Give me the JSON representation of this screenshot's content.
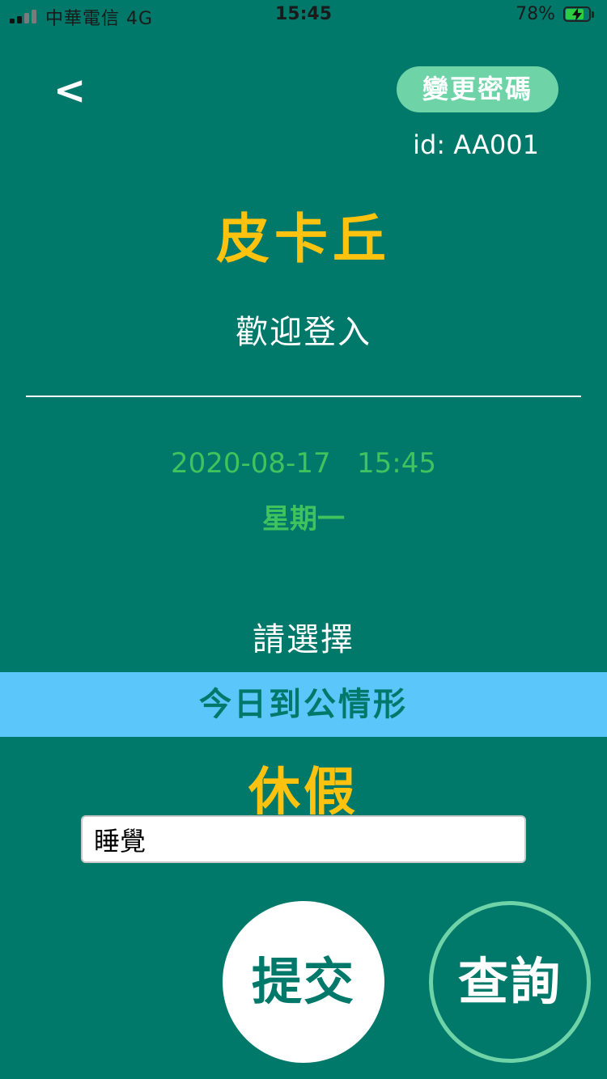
{
  "status_bar": {
    "carrier": "中華電信  4G",
    "time": "15:45",
    "battery_percent": "78%",
    "battery_level": 0.78,
    "battery_charging": true,
    "signal_bars": 2
  },
  "header": {
    "back_label": "<",
    "change_password_label": "變更密碼",
    "user_id": "id: AA001"
  },
  "profile": {
    "name": "皮卡丘",
    "welcome": "歡迎登入"
  },
  "datetime": {
    "date_time": "2020-08-17   15:45",
    "weekday": "星期一"
  },
  "selection": {
    "prompt": "請選擇",
    "option": "今日到公情形",
    "selected": "休假",
    "note_value": "睡覺"
  },
  "actions": {
    "submit_label": "提交",
    "query_label": "查詢"
  },
  "colors": {
    "background": "#00796b",
    "accent_yellow": "#ffc20e",
    "accent_green": "#3fc35d",
    "option_blue": "#5bc6fa",
    "mint": "#6fd3a8"
  }
}
